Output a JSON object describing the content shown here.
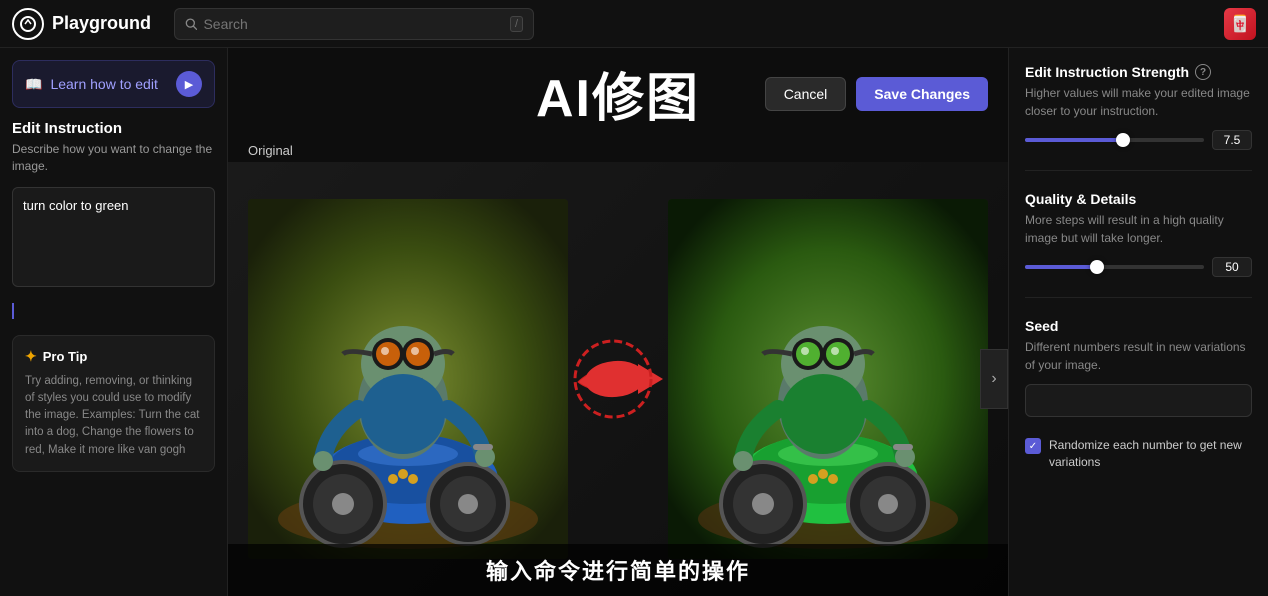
{
  "nav": {
    "logo_text": "Playground",
    "search_placeholder": "Search",
    "search_shortcut": "/",
    "avatar_emoji": "🀄"
  },
  "left_sidebar": {
    "learn_btn_label": "Learn how to edit",
    "edit_instruction_title": "Edit Instruction",
    "edit_instruction_desc": "Describe how you want to change the image.",
    "instruction_value": "turn color to green",
    "pro_tip_title": "Pro Tip",
    "pro_tip_text": "Try adding, removing, or thinking of styles you could use to modify the image. Examples: Turn the cat into a dog, Change the flowers to red, Make it more like van gogh"
  },
  "center": {
    "ai_title": "AI修图",
    "cancel_label": "Cancel",
    "save_label": "Save Changes",
    "original_label": "Original",
    "chinese_subtitle": "输入命令进行简单的操作"
  },
  "right_sidebar": {
    "strength_title": "Edit Instruction Strength",
    "strength_desc": "Higher values will make your edited image closer to your instruction.",
    "strength_value": "7.5",
    "strength_percent": 55,
    "quality_title": "Quality & Details",
    "quality_desc": "More steps will result in a high quality image but will take longer.",
    "quality_value": "50",
    "quality_percent": 40,
    "seed_title": "Seed",
    "seed_desc": "Different numbers result in new variations of your image.",
    "seed_value": "",
    "randomize_label": "Randomize each number to get new variations"
  }
}
